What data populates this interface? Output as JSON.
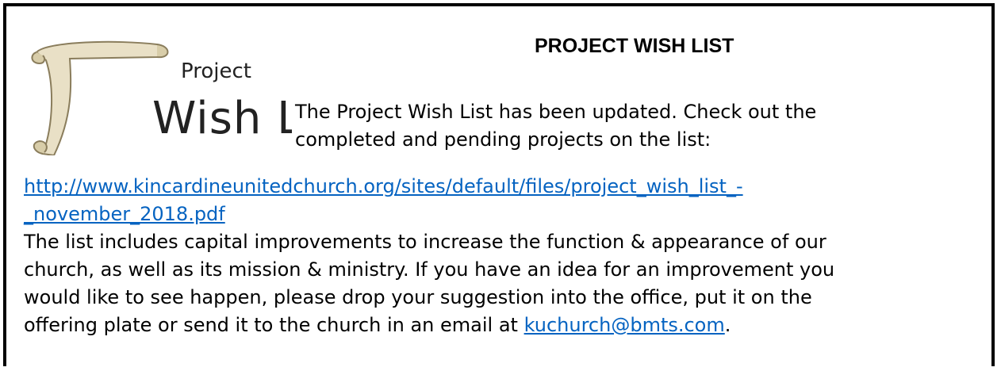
{
  "logo": {
    "line1": "Project",
    "line2": "Wish List"
  },
  "title": "PROJECT WISH LIST",
  "intro": {
    "line1": "The Project Wish List has been updated. Check out the",
    "line2": "completed and pending projects on the list:"
  },
  "url": {
    "line1": "http://www.kincardineunitedchurch.org/sites/default/files/project_wish_list_-",
    "line2": "_november_2018.pdf"
  },
  "body": {
    "line1": "The list includes capital improvements to increase the function & appearance of our",
    "line2": "church, as well as its mission & ministry. If you  have an idea for an improvement you",
    "line3": "would like to see happen, please drop your suggestion into the office, put it on the",
    "line4_prefix": "offering plate or send it to the church in an email at ",
    "email": "kuchurch@bmts.com",
    "line4_suffix": "."
  }
}
